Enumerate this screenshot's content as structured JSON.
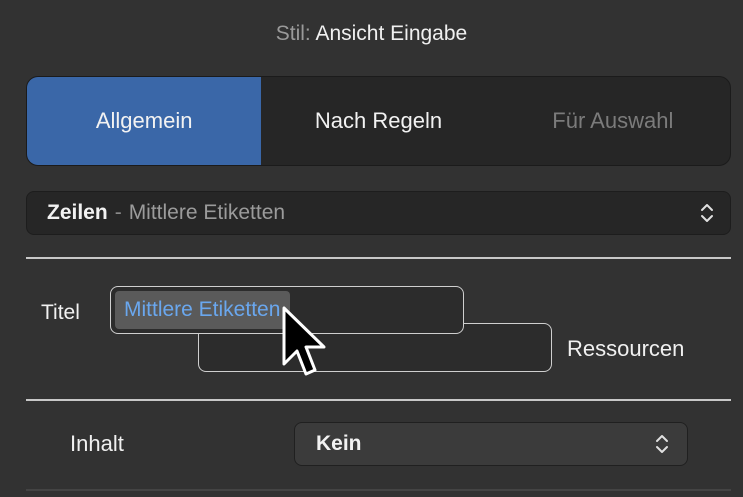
{
  "header": {
    "label": "Stil:",
    "value": "Ansicht Eingabe"
  },
  "segments": [
    {
      "label": "Allgemein",
      "state": "active"
    },
    {
      "label": "Nach Regeln",
      "state": "normal"
    },
    {
      "label": "Für Auswahl",
      "state": "disabled"
    }
  ],
  "row_selector": {
    "main": "Zeilen",
    "separator": "-",
    "sub": "Mittlere Etiketten"
  },
  "titel": {
    "label": "Titel",
    "value": "Mittlere Etiketten"
  },
  "ressourcen": {
    "label": "Ressourcen"
  },
  "inhalt": {
    "label": "Inhalt",
    "selected": "Kein"
  },
  "colors": {
    "accent": "#3a67a8",
    "text_blue": "#6aa7ee",
    "background": "#323232"
  }
}
